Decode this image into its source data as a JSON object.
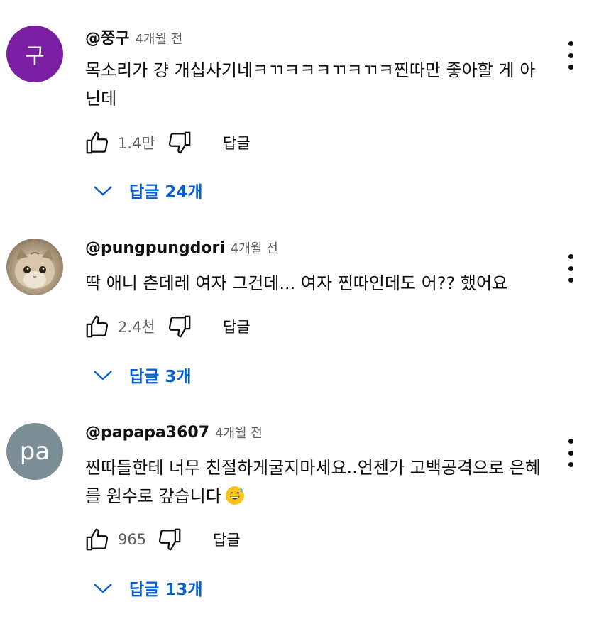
{
  "comments": [
    {
      "avatar_letter": "구",
      "handle": "@쭝구",
      "time": "4개월 전",
      "text": "목소리가 걍 개십사기네ㅋㄲㅋㅋㅋㄲㅋㄲㅋ찐따만 좋아할 게 아닌데",
      "likes": "1.4만",
      "reply_label": "답글",
      "replies_label": "답글 24개"
    },
    {
      "handle": "@pungpungdori",
      "time": "4개월 전",
      "text": "딱 애니 츤데레 여자 그건데... 여자 찐따인데도 어?? 했어요",
      "likes": "2.4천",
      "reply_label": "답글",
      "replies_label": "답글 3개"
    },
    {
      "avatar_letter": "pa",
      "handle": "@papapa3607",
      "time": "4개월 전",
      "text": "찐따들한테 너무 친절하게굴지마세요..언젠가 고백공격으로 은혜를 원수로 갚습니다",
      "emoji": "sweat-smile-emoji",
      "likes": "965",
      "reply_label": "답글",
      "replies_label": "답글 13개"
    }
  ],
  "colors": {
    "link": "#065fd4",
    "meta": "#606060",
    "avatar1": "#7b1fa2",
    "avatar3": "#7b8e96"
  },
  "icons": [
    "thumbs-up-icon",
    "thumbs-down-icon",
    "more-vert-icon",
    "chevron-down-icon"
  ]
}
